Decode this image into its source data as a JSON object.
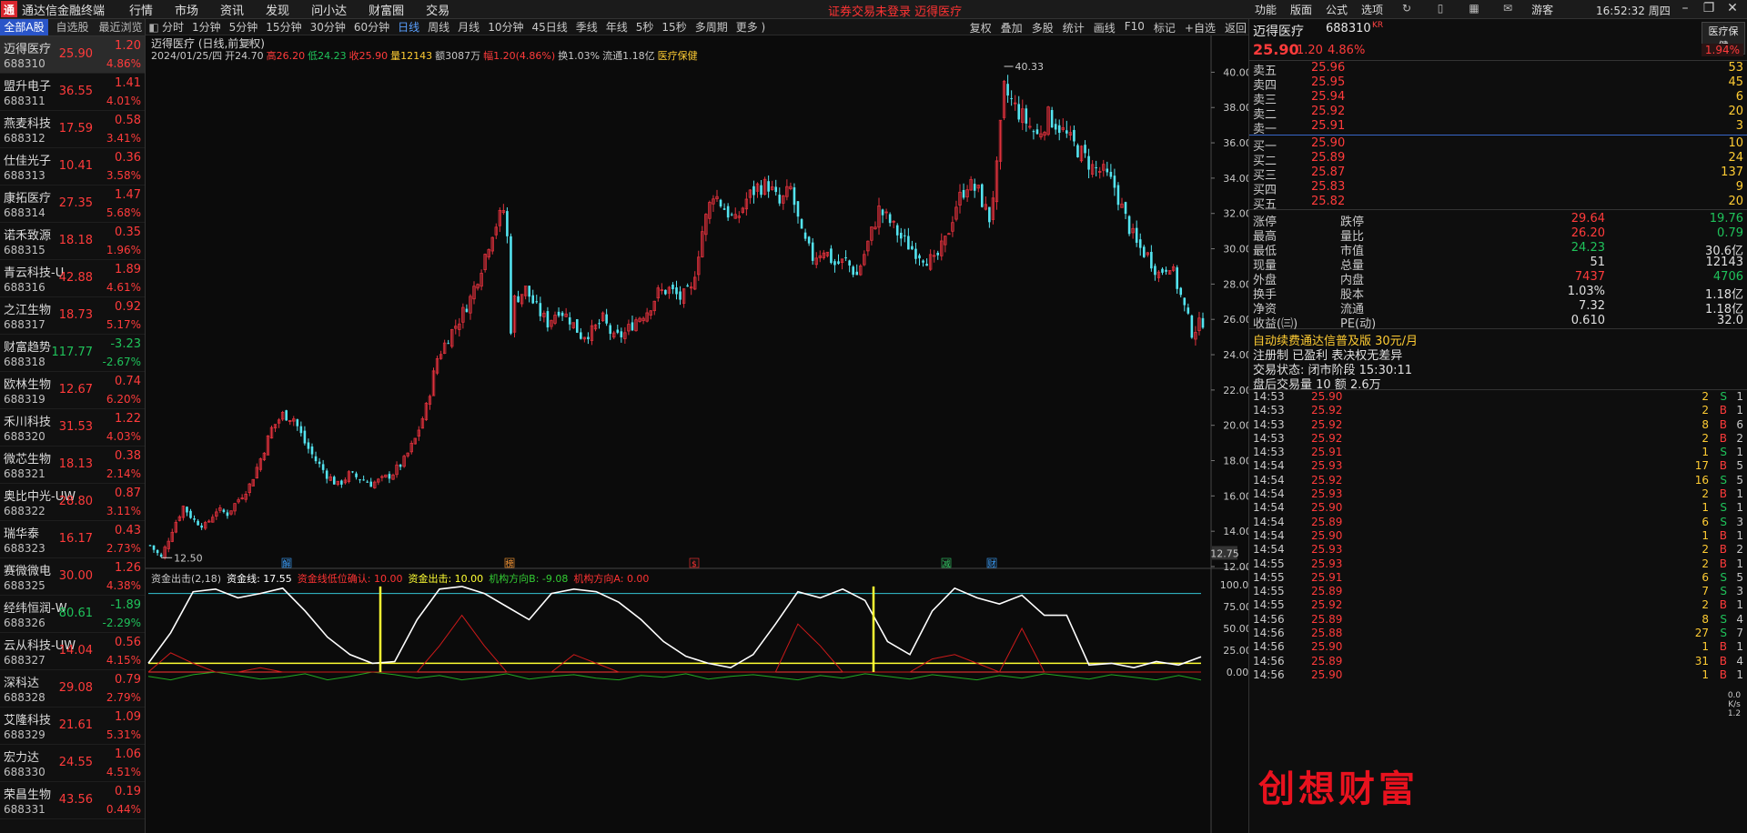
{
  "app": {
    "title": "通达信金融终端",
    "logo_text": "通",
    "menu": [
      "行情",
      "市场",
      "资讯",
      "发现",
      "问小达",
      "财富圈",
      "交易"
    ],
    "status_text": "证券交易未登录   迈得医疗",
    "right_menu": [
      "功能",
      "版面",
      "公式",
      "选项"
    ],
    "user": "游客",
    "clock": "16:52:32 周四"
  },
  "sidebar": {
    "tabs": [
      "全部A股",
      "自选股",
      "最近浏览"
    ],
    "stocks": [
      {
        "name": "迈得医疗",
        "code": "688310",
        "price": "25.90",
        "change": "1.20",
        "pct": "4.86%",
        "up": true
      },
      {
        "name": "盟升电子",
        "code": "688311",
        "price": "36.55",
        "change": "1.41",
        "pct": "4.01%",
        "up": true
      },
      {
        "name": "燕麦科技",
        "code": "688312",
        "price": "17.59",
        "change": "0.58",
        "pct": "3.41%",
        "up": true
      },
      {
        "name": "仕佳光子",
        "code": "688313",
        "price": "10.41",
        "change": "0.36",
        "pct": "3.58%",
        "up": true
      },
      {
        "name": "康拓医疗",
        "code": "688314",
        "price": "27.35",
        "change": "1.47",
        "pct": "5.68%",
        "up": true
      },
      {
        "name": "诺禾致源",
        "code": "688315",
        "price": "18.18",
        "change": "0.35",
        "pct": "1.96%",
        "up": true
      },
      {
        "name": "青云科技-U",
        "code": "688316",
        "price": "42.88",
        "change": "1.89",
        "pct": "4.61%",
        "up": true
      },
      {
        "name": "之江生物",
        "code": "688317",
        "price": "18.73",
        "change": "0.92",
        "pct": "5.17%",
        "up": true
      },
      {
        "name": "财富趋势",
        "code": "688318",
        "price": "117.77",
        "change": "-3.23",
        "pct": "-2.67%",
        "up": false
      },
      {
        "name": "欧林生物",
        "code": "688319",
        "price": "12.67",
        "change": "0.74",
        "pct": "6.20%",
        "up": true
      },
      {
        "name": "禾川科技",
        "code": "688320",
        "price": "31.53",
        "change": "1.22",
        "pct": "4.03%",
        "up": true
      },
      {
        "name": "微芯生物",
        "code": "688321",
        "price": "18.13",
        "change": "0.38",
        "pct": "2.14%",
        "up": true
      },
      {
        "name": "奥比中光-UW",
        "code": "688322",
        "price": "28.80",
        "change": "0.87",
        "pct": "3.11%",
        "up": true
      },
      {
        "name": "瑞华泰",
        "code": "688323",
        "price": "16.17",
        "change": "0.43",
        "pct": "2.73%",
        "up": true
      },
      {
        "name": "赛微微电",
        "code": "688325",
        "price": "30.00",
        "change": "1.26",
        "pct": "4.38%",
        "up": true
      },
      {
        "name": "经纬恒润-W",
        "code": "688326",
        "price": "80.61",
        "change": "-1.89",
        "pct": "-2.29%",
        "up": false
      },
      {
        "name": "云从科技-UW",
        "code": "688327",
        "price": "14.04",
        "change": "0.56",
        "pct": "4.15%",
        "up": true
      },
      {
        "name": "深科达",
        "code": "688328",
        "price": "29.08",
        "change": "0.79",
        "pct": "2.79%",
        "up": true
      },
      {
        "name": "艾隆科技",
        "code": "688329",
        "price": "21.61",
        "change": "1.09",
        "pct": "5.31%",
        "up": true
      },
      {
        "name": "宏力达",
        "code": "688330",
        "price": "24.55",
        "change": "1.06",
        "pct": "4.51%",
        "up": true
      },
      {
        "name": "荣昌生物",
        "code": "688331",
        "price": "43.56",
        "change": "0.19",
        "pct": "0.44%",
        "up": true
      }
    ]
  },
  "toolbar": {
    "periods": [
      "分时",
      "1分钟",
      "5分钟",
      "15分钟",
      "30分钟",
      "60分钟",
      "日线",
      "周线",
      "月线",
      "10分钟",
      "45日线",
      "季线",
      "年线",
      "5秒",
      "15秒",
      "多周期",
      "更多 )"
    ],
    "active_period": "日线",
    "right": [
      "复权",
      "叠加",
      "多股",
      "统计",
      "画线",
      "F10",
      "标记",
      "+自选",
      "返回"
    ]
  },
  "chart": {
    "title": "迈得医疗 (日线,前复权)",
    "ohlc": [
      {
        "text": "2024/01/25/四",
        "color": "#c8c8c8"
      },
      {
        "text": "开24.70",
        "color": "#c8c8c8"
      },
      {
        "text": "高26.20",
        "color": "#ff3b3b"
      },
      {
        "text": "低24.23",
        "color": "#1fc25a"
      },
      {
        "text": "收25.90",
        "color": "#ff3b3b"
      },
      {
        "text": "量12143",
        "color": "#ffcc33"
      },
      {
        "text": "额3087万",
        "color": "#c8c8c8"
      },
      {
        "text": "幅1.20(4.86%)",
        "color": "#ff3b3b"
      },
      {
        "text": "换1.03%",
        "color": "#c8c8c8"
      },
      {
        "text": "流通1.18亿",
        "color": "#c8c8c8"
      },
      {
        "text": "医疗保健",
        "color": "#ffcc33"
      }
    ],
    "y_ticks": [
      "40.00",
      "38.00",
      "36.00",
      "34.00",
      "32.00",
      "30.00",
      "28.00",
      "26.00",
      "24.00",
      "22.00",
      "20.00",
      "18.00",
      "16.00",
      "14.00",
      "12.00"
    ],
    "high_label": "40.33",
    "low_label": "12.50",
    "cursor_price": "12.75",
    "event_markers": [
      {
        "label": "解",
        "color": "#3aa0ff"
      },
      {
        "label": "榜",
        "color": "#ff9933"
      },
      {
        "label": "$",
        "color": "#ff3333"
      },
      {
        "label": "减",
        "color": "#33cc66"
      },
      {
        "label": "财",
        "color": "#3aa0ff"
      }
    ],
    "indicator": {
      "legend": [
        {
          "text": "资金出击(2,18)",
          "color": "#c8c8c8"
        },
        {
          "text": "资金线: 17.55",
          "color": "#ffffff"
        },
        {
          "text": "资金线低位确认: 10.00",
          "color": "#ff3333"
        },
        {
          "text": "资金出击: 10.00",
          "color": "#ffff33"
        },
        {
          "text": "机构方向B: -9.08",
          "color": "#33cc33"
        },
        {
          "text": "机构方向A: 0.00",
          "color": "#ff3333"
        }
      ],
      "y_ticks": [
        "100.00",
        "75.00",
        "50.00",
        "25.00",
        "0.00"
      ]
    }
  },
  "chart_data": {
    "type": "candlestick",
    "title": "迈得医疗 (日线,前复权)",
    "ylim": [
      12,
      40.33
    ],
    "close_points": [
      [
        0,
        13.2
      ],
      [
        3,
        12.5
      ],
      [
        6,
        14.1
      ],
      [
        9,
        15.4
      ],
      [
        12,
        14.6
      ],
      [
        15,
        14.3
      ],
      [
        18,
        15.2
      ],
      [
        21,
        15.0
      ],
      [
        24,
        15.8
      ],
      [
        27,
        16.6
      ],
      [
        30,
        18.1
      ],
      [
        33,
        19.8
      ],
      [
        36,
        20.6
      ],
      [
        39,
        20.4
      ],
      [
        42,
        19.0
      ],
      [
        45,
        18.0
      ],
      [
        48,
        17.2
      ],
      [
        51,
        16.6
      ],
      [
        54,
        17.2
      ],
      [
        57,
        17.0
      ],
      [
        60,
        16.7
      ],
      [
        63,
        16.9
      ],
      [
        66,
        17.3
      ],
      [
        69,
        18.0
      ],
      [
        72,
        19.2
      ],
      [
        75,
        21.0
      ],
      [
        78,
        23.8
      ],
      [
        81,
        25.0
      ],
      [
        84,
        26.0
      ],
      [
        87,
        27.2
      ],
      [
        90,
        29.0
      ],
      [
        93,
        31.0
      ],
      [
        96,
        32.2
      ],
      [
        97,
        30.6
      ],
      [
        98,
        25.5
      ],
      [
        99,
        27.1
      ],
      [
        102,
        27.7
      ],
      [
        105,
        26.6
      ],
      [
        108,
        25.8
      ],
      [
        111,
        26.6
      ],
      [
        114,
        26.0
      ],
      [
        117,
        25.1
      ],
      [
        120,
        25.3
      ],
      [
        123,
        26.0
      ],
      [
        126,
        24.9
      ],
      [
        129,
        25.2
      ],
      [
        132,
        26.0
      ],
      [
        135,
        26.5
      ],
      [
        138,
        27.5
      ],
      [
        141,
        27.7
      ],
      [
        144,
        27.2
      ],
      [
        147,
        27.6
      ],
      [
        150,
        31.0
      ],
      [
        153,
        33.2
      ],
      [
        156,
        32.3
      ],
      [
        159,
        31.5
      ],
      [
        162,
        32.8
      ],
      [
        165,
        33.5
      ],
      [
        168,
        33.6
      ],
      [
        171,
        32.5
      ],
      [
        174,
        33.4
      ],
      [
        177,
        30.7
      ],
      [
        180,
        29.5
      ],
      [
        183,
        30.0
      ],
      [
        186,
        29.1
      ],
      [
        189,
        29.3
      ],
      [
        192,
        28.5
      ],
      [
        195,
        30.3
      ],
      [
        198,
        32.2
      ],
      [
        201,
        31.5
      ],
      [
        204,
        30.6
      ],
      [
        207,
        30.0
      ],
      [
        210,
        29.6
      ],
      [
        213,
        29.2
      ],
      [
        216,
        30.4
      ],
      [
        219,
        32.5
      ],
      [
        222,
        33.7
      ],
      [
        225,
        33.2
      ],
      [
        228,
        31.7
      ],
      [
        230,
        34.5
      ],
      [
        232,
        39.0
      ],
      [
        235,
        38.0
      ],
      [
        238,
        37.2
      ],
      [
        241,
        36.4
      ],
      [
        244,
        37.5
      ],
      [
        247,
        36.9
      ],
      [
        250,
        36.1
      ],
      [
        253,
        35.4
      ],
      [
        256,
        34.6
      ],
      [
        259,
        34.3
      ],
      [
        262,
        33.5
      ],
      [
        265,
        31.7
      ],
      [
        268,
        30.2
      ],
      [
        271,
        29.6
      ],
      [
        274,
        28.6
      ],
      [
        277,
        29.2
      ],
      [
        280,
        27.3
      ],
      [
        283,
        25.3
      ],
      [
        286,
        25.9
      ]
    ],
    "indicator_series": [
      {
        "name": "资金线",
        "values": [
          10,
          45,
          92,
          95,
          85,
          90,
          96,
          70,
          40,
          20,
          10,
          12,
          60,
          95,
          98,
          90,
          75,
          60,
          90,
          95,
          92,
          80,
          60,
          35,
          18,
          10,
          5,
          20,
          55,
          92,
          85,
          95,
          82,
          35,
          20,
          70,
          96,
          85,
          78,
          88,
          65,
          65,
          8,
          10,
          5,
          12,
          8,
          17.55
        ]
      },
      {
        "name": "资金线低位确认",
        "values": [
          10,
          10,
          10,
          10,
          10,
          10,
          10,
          10,
          10,
          10,
          10,
          10,
          10,
          10,
          10,
          10,
          10,
          10,
          10,
          10,
          10,
          10,
          10,
          10,
          10,
          10,
          10,
          10,
          10,
          10,
          10,
          10,
          10,
          10,
          10,
          10,
          10,
          10,
          10,
          10,
          10,
          10,
          10,
          10,
          10,
          10,
          10,
          10
        ]
      },
      {
        "name": "机构方向A",
        "values": [
          0,
          22,
          10,
          0,
          0,
          5,
          0,
          0,
          0,
          0,
          0,
          0,
          0,
          30,
          65,
          30,
          0,
          0,
          0,
          20,
          10,
          0,
          0,
          0,
          0,
          0,
          0,
          0,
          0,
          55,
          30,
          0,
          0,
          0,
          0,
          15,
          20,
          10,
          0,
          50,
          0,
          0,
          0,
          0,
          0,
          0,
          0,
          0
        ]
      },
      {
        "name": "机构方向B",
        "values": [
          -5,
          -9,
          -3,
          0,
          -4,
          -8,
          -6,
          -2,
          -9,
          -5,
          0,
          -3,
          -7,
          -4,
          -9,
          -6,
          -2,
          -8,
          -5,
          -3,
          -7,
          -9,
          -4,
          -6,
          -2,
          -8,
          -5,
          -3,
          -6,
          -9,
          -4,
          -7,
          -2,
          -5,
          -8,
          -3,
          -6,
          -9,
          -4,
          -7,
          -2,
          -5,
          -8,
          -3,
          -6,
          -9,
          -4,
          -9.08
        ]
      }
    ]
  },
  "panel": {
    "name": "迈得医疗",
    "code": "688310",
    "badge": "KR",
    "sector": "医疗保健",
    "price": "25.90",
    "change": "1.20",
    "pct": "4.86%",
    "pct2": "1.94%",
    "asks": [
      {
        "label": "卖五",
        "price": "25.96",
        "vol": "53"
      },
      {
        "label": "卖四",
        "price": "25.95",
        "vol": "45"
      },
      {
        "label": "卖三",
        "price": "25.94",
        "vol": "6"
      },
      {
        "label": "卖二",
        "price": "25.92",
        "vol": "20"
      },
      {
        "label": "卖一",
        "price": "25.91",
        "vol": "3"
      }
    ],
    "bids": [
      {
        "label": "买一",
        "price": "25.90",
        "vol": "10"
      },
      {
        "label": "买二",
        "price": "25.89",
        "vol": "24"
      },
      {
        "label": "买三",
        "price": "25.87",
        "vol": "137"
      },
      {
        "label": "买四",
        "price": "25.83",
        "vol": "9"
      },
      {
        "label": "买五",
        "price": "25.82",
        "vol": "20"
      }
    ],
    "stats": [
      {
        "l1": "涨停",
        "v1": "29.64",
        "c1": "red",
        "l2": "跌停",
        "v2": "19.76",
        "c2": "green"
      },
      {
        "l1": "最高",
        "v1": "26.20",
        "c1": "red",
        "l2": "量比",
        "v2": "0.79",
        "c2": "green"
      },
      {
        "l1": "最低",
        "v1": "24.23",
        "c1": "green",
        "l2": "市值",
        "v2": "30.6亿",
        "c2": "white"
      },
      {
        "l1": "现量",
        "v1": "51",
        "c1": "white",
        "l2": "总量",
        "v2": "12143",
        "c2": "white"
      },
      {
        "l1": "外盘",
        "v1": "7437",
        "c1": "red",
        "l2": "内盘",
        "v2": "4706",
        "c2": "green"
      },
      {
        "l1": "换手",
        "v1": "1.03%",
        "c1": "white",
        "l2": "股本",
        "v2": "1.18亿",
        "c2": "white"
      },
      {
        "l1": "净资",
        "v1": "7.32",
        "c1": "white",
        "l2": "流通",
        "v2": "1.18亿",
        "c2": "white"
      },
      {
        "l1": "收益(㈢)",
        "v1": "0.610",
        "c1": "white",
        "l2": "PE(动)",
        "v2": "32.0",
        "c2": "white"
      }
    ],
    "promo": "自动续费通达信普及版   30元/月",
    "reg": "注册制  已盈利  表决权无差异",
    "status": "交易状态: 闭市阶段 15:30:11",
    "after_hours": "盘后交易量 10 额 2.6万",
    "ticks": [
      {
        "t": "14:53",
        "p": "25.90",
        "v": "2",
        "s": "S",
        "n": "1",
        "pc": "red",
        "sc": "green"
      },
      {
        "t": "14:53",
        "p": "25.92",
        "v": "2",
        "s": "B",
        "n": "1",
        "pc": "red",
        "sc": "red"
      },
      {
        "t": "14:53",
        "p": "25.92",
        "v": "8",
        "s": "B",
        "n": "6",
        "pc": "red",
        "sc": "red"
      },
      {
        "t": "14:53",
        "p": "25.92",
        "v": "2",
        "s": "B",
        "n": "2",
        "pc": "red",
        "sc": "red"
      },
      {
        "t": "14:53",
        "p": "25.91",
        "v": "1",
        "s": "S",
        "n": "1",
        "pc": "red",
        "sc": "green"
      },
      {
        "t": "14:54",
        "p": "25.93",
        "v": "17",
        "s": "B",
        "n": "5",
        "pc": "red",
        "sc": "red"
      },
      {
        "t": "14:54",
        "p": "25.92",
        "v": "16",
        "s": "S",
        "n": "5",
        "pc": "red",
        "sc": "green"
      },
      {
        "t": "14:54",
        "p": "25.93",
        "v": "2",
        "s": "B",
        "n": "1",
        "pc": "red",
        "sc": "red"
      },
      {
        "t": "14:54",
        "p": "25.90",
        "v": "1",
        "s": "S",
        "n": "1",
        "pc": "red",
        "sc": "green"
      },
      {
        "t": "14:54",
        "p": "25.89",
        "v": "6",
        "s": "S",
        "n": "3",
        "pc": "red",
        "sc": "green"
      },
      {
        "t": "14:54",
        "p": "25.90",
        "v": "1",
        "s": "B",
        "n": "1",
        "pc": "red",
        "sc": "red"
      },
      {
        "t": "14:54",
        "p": "25.93",
        "v": "2",
        "s": "B",
        "n": "2",
        "pc": "red",
        "sc": "red"
      },
      {
        "t": "14:55",
        "p": "25.93",
        "v": "2",
        "s": "B",
        "n": "1",
        "pc": "red",
        "sc": "red"
      },
      {
        "t": "14:55",
        "p": "25.91",
        "v": "6",
        "s": "S",
        "n": "5",
        "pc": "red",
        "sc": "green"
      },
      {
        "t": "14:55",
        "p": "25.89",
        "v": "7",
        "s": "S",
        "n": "3",
        "pc": "red",
        "sc": "green"
      },
      {
        "t": "14:55",
        "p": "25.92",
        "v": "2",
        "s": "B",
        "n": "1",
        "pc": "red",
        "sc": "red"
      },
      {
        "t": "14:56",
        "p": "25.89",
        "v": "8",
        "s": "S",
        "n": "4",
        "pc": "red",
        "sc": "green"
      },
      {
        "t": "14:56",
        "p": "25.88",
        "v": "27",
        "s": "S",
        "n": "7",
        "pc": "red",
        "sc": "green"
      },
      {
        "t": "14:56",
        "p": "25.90",
        "v": "1",
        "s": "B",
        "n": "1",
        "pc": "red",
        "sc": "red"
      },
      {
        "t": "14:56",
        "p": "25.89",
        "v": "31",
        "s": "B",
        "n": "4",
        "pc": "red",
        "sc": "red"
      },
      {
        "t": "14:56",
        "p": "25.90",
        "v": "1",
        "s": "B",
        "n": "1",
        "pc": "red",
        "sc": "red"
      }
    ]
  },
  "watermark": "创想财富",
  "side_widget": {
    "pct": "0.0",
    "unit": "K/s",
    "v2": "1.2"
  }
}
